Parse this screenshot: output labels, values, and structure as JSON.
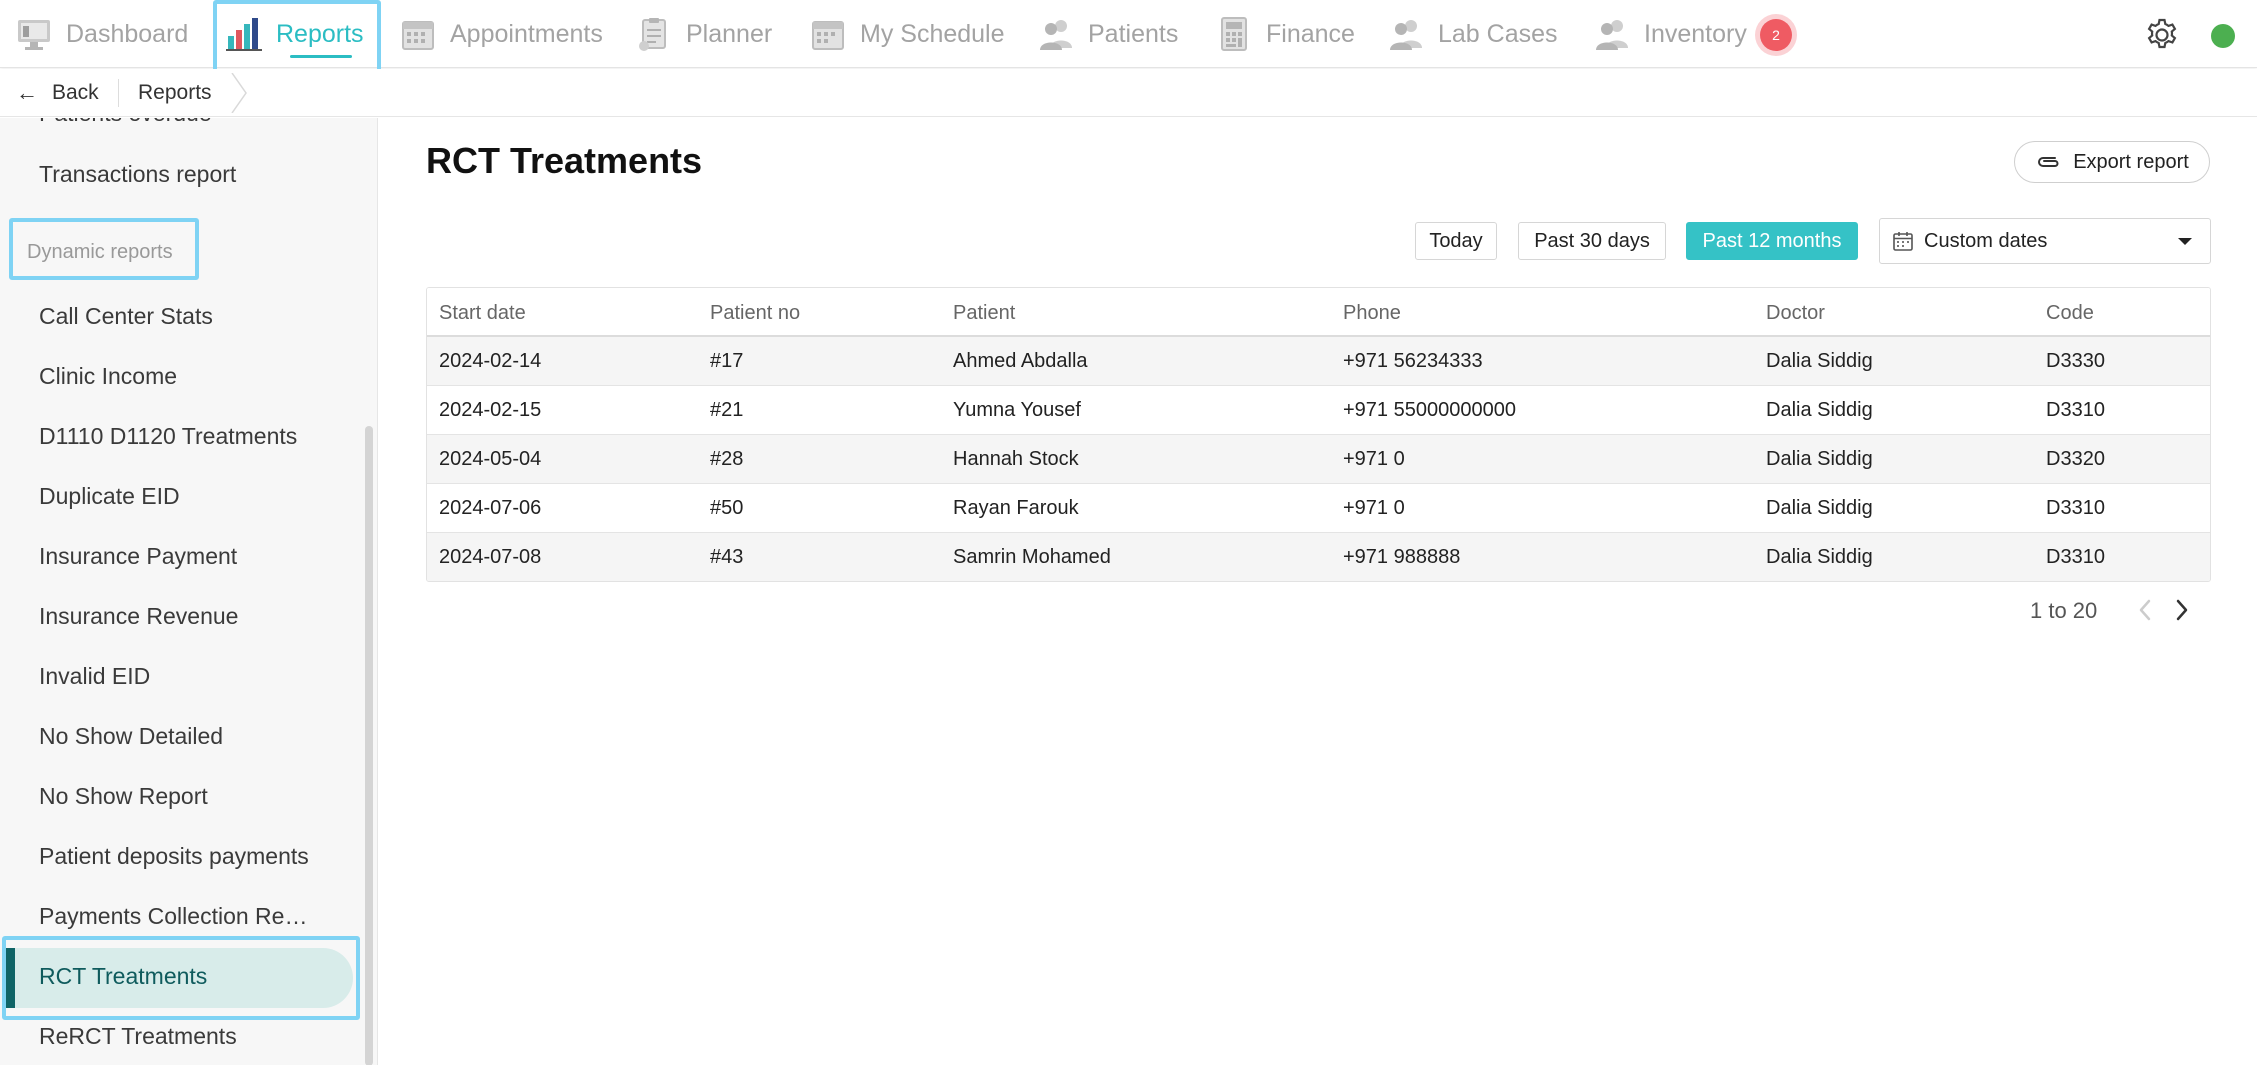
{
  "nav": {
    "items": [
      {
        "label": "Dashboard",
        "icon": "monitor-icon"
      },
      {
        "label": "Reports",
        "icon": "bar-chart-icon",
        "active": true
      },
      {
        "label": "Appointments",
        "icon": "calendar-icon"
      },
      {
        "label": "Planner",
        "icon": "clipboard-icon"
      },
      {
        "label": "My Schedule",
        "icon": "calendar-icon"
      },
      {
        "label": "Patients",
        "icon": "users-icon"
      },
      {
        "label": "Finance",
        "icon": "calculator-icon"
      },
      {
        "label": "Lab Cases",
        "icon": "users-icon"
      },
      {
        "label": "Inventory",
        "icon": "users-icon"
      }
    ],
    "inventory_badge": "2",
    "accent_color": "#2bbdc3",
    "status_color": "#4caf50"
  },
  "subbar": {
    "back_label": "Back",
    "breadcrumb": "Reports"
  },
  "sidebar": {
    "cut_item": "Patients overdue",
    "items_top": [
      "Transactions report"
    ],
    "section_label": "Dynamic reports",
    "items": [
      "Call Center Stats",
      "Clinic Income",
      "D1110 D1120 Treatments",
      "Duplicate EID",
      "Insurance Payment",
      "Insurance Revenue",
      "Invalid EID",
      "No Show Detailed",
      "No Show Report",
      "Patient deposits payments",
      "Payments Collection Re…",
      "RCT Treatments",
      "ReRCT Treatments"
    ],
    "active_item": "RCT Treatments"
  },
  "main": {
    "title": "RCT Treatments",
    "export_label": "Export report",
    "ranges": [
      "Today",
      "Past 30 days",
      "Past 12 months"
    ],
    "active_range": "Past 12 months",
    "custom_dates_label": "Custom dates",
    "table": {
      "columns": [
        "Start date",
        "Patient no",
        "Patient",
        "Phone",
        "Doctor",
        "Code"
      ],
      "rows": [
        [
          "2024-02-14",
          "#17",
          "Ahmed Abdalla",
          "+971 56234333",
          "Dalia Siddig",
          "D3330"
        ],
        [
          "2024-02-15",
          "#21",
          "Yumna Yousef",
          "+971 55000000000",
          "Dalia Siddig",
          "D3310"
        ],
        [
          "2024-05-04",
          "#28",
          "Hannah Stock",
          "+971 0",
          "Dalia Siddig",
          "D3320"
        ],
        [
          "2024-07-06",
          "#50",
          "Rayan Farouk",
          "+971 0",
          "Dalia Siddig",
          "D3310"
        ],
        [
          "2024-07-08",
          "#43",
          "Samrin Mohamed",
          "+971 988888",
          "Dalia Siddig",
          "D3310"
        ]
      ]
    },
    "pager_text": "1 to 20"
  }
}
